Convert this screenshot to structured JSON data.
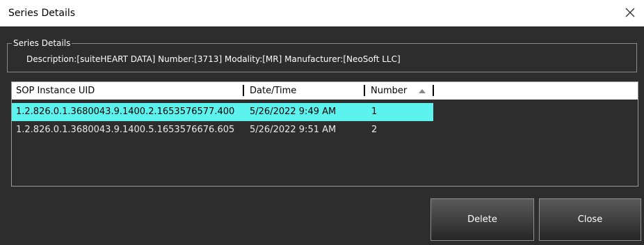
{
  "window": {
    "title": "Series Details"
  },
  "group": {
    "legend": "Series Details",
    "details_text": "Description:[suiteHEART DATA] Number:[3713] Modality:[MR] Manufacturer:[NeoSoft LLC]"
  },
  "table": {
    "columns": [
      "SOP Instance UID",
      "Date/Time",
      "Number"
    ],
    "sort_column": "Number",
    "sort_direction": "ascending",
    "rows": [
      {
        "uid": "1.2.826.0.1.3680043.9.1400.2.1653576577.400",
        "datetime": "5/26/2022 9:49 AM",
        "number": "1",
        "selected": true
      },
      {
        "uid": "1.2.826.0.1.3680043.9.1400.5.1653576676.605",
        "datetime": "5/26/2022 9:51 AM",
        "number": "2",
        "selected": false
      }
    ]
  },
  "buttons": {
    "delete_label": "Delete",
    "close_label": "Close"
  },
  "colors": {
    "selection": "#5cf3ee",
    "background": "#2d2d2d"
  },
  "icons": {
    "close": "close-x-icon",
    "sort": "sort-ascending-icon"
  }
}
